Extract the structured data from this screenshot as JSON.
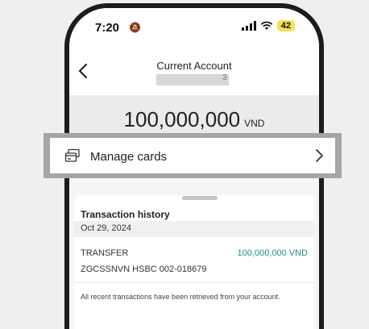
{
  "status_bar": {
    "time": "7:20",
    "bell_icon": "bell-mute-icon",
    "battery": "42",
    "battery_color": "#f6e24a"
  },
  "header": {
    "title": "Current Account",
    "account_suffix": "3",
    "back_icon": "chevron-left-icon"
  },
  "balance": {
    "amount": "100,000,000",
    "currency": "VND"
  },
  "manage_cards": {
    "label": "Manage cards",
    "icon": "card-icon",
    "chevron": "chevron-right-icon"
  },
  "transactions": {
    "title": "Transaction history",
    "date": "Oct 29, 2024",
    "items": [
      {
        "type": "TRANSFER",
        "amount": "100,000,000 VND",
        "description": "ZGCSSNVN HSBC 002-018679",
        "amount_color": "#1d8f83"
      }
    ],
    "notice": "All recent transactions have been retrieved from your account."
  }
}
